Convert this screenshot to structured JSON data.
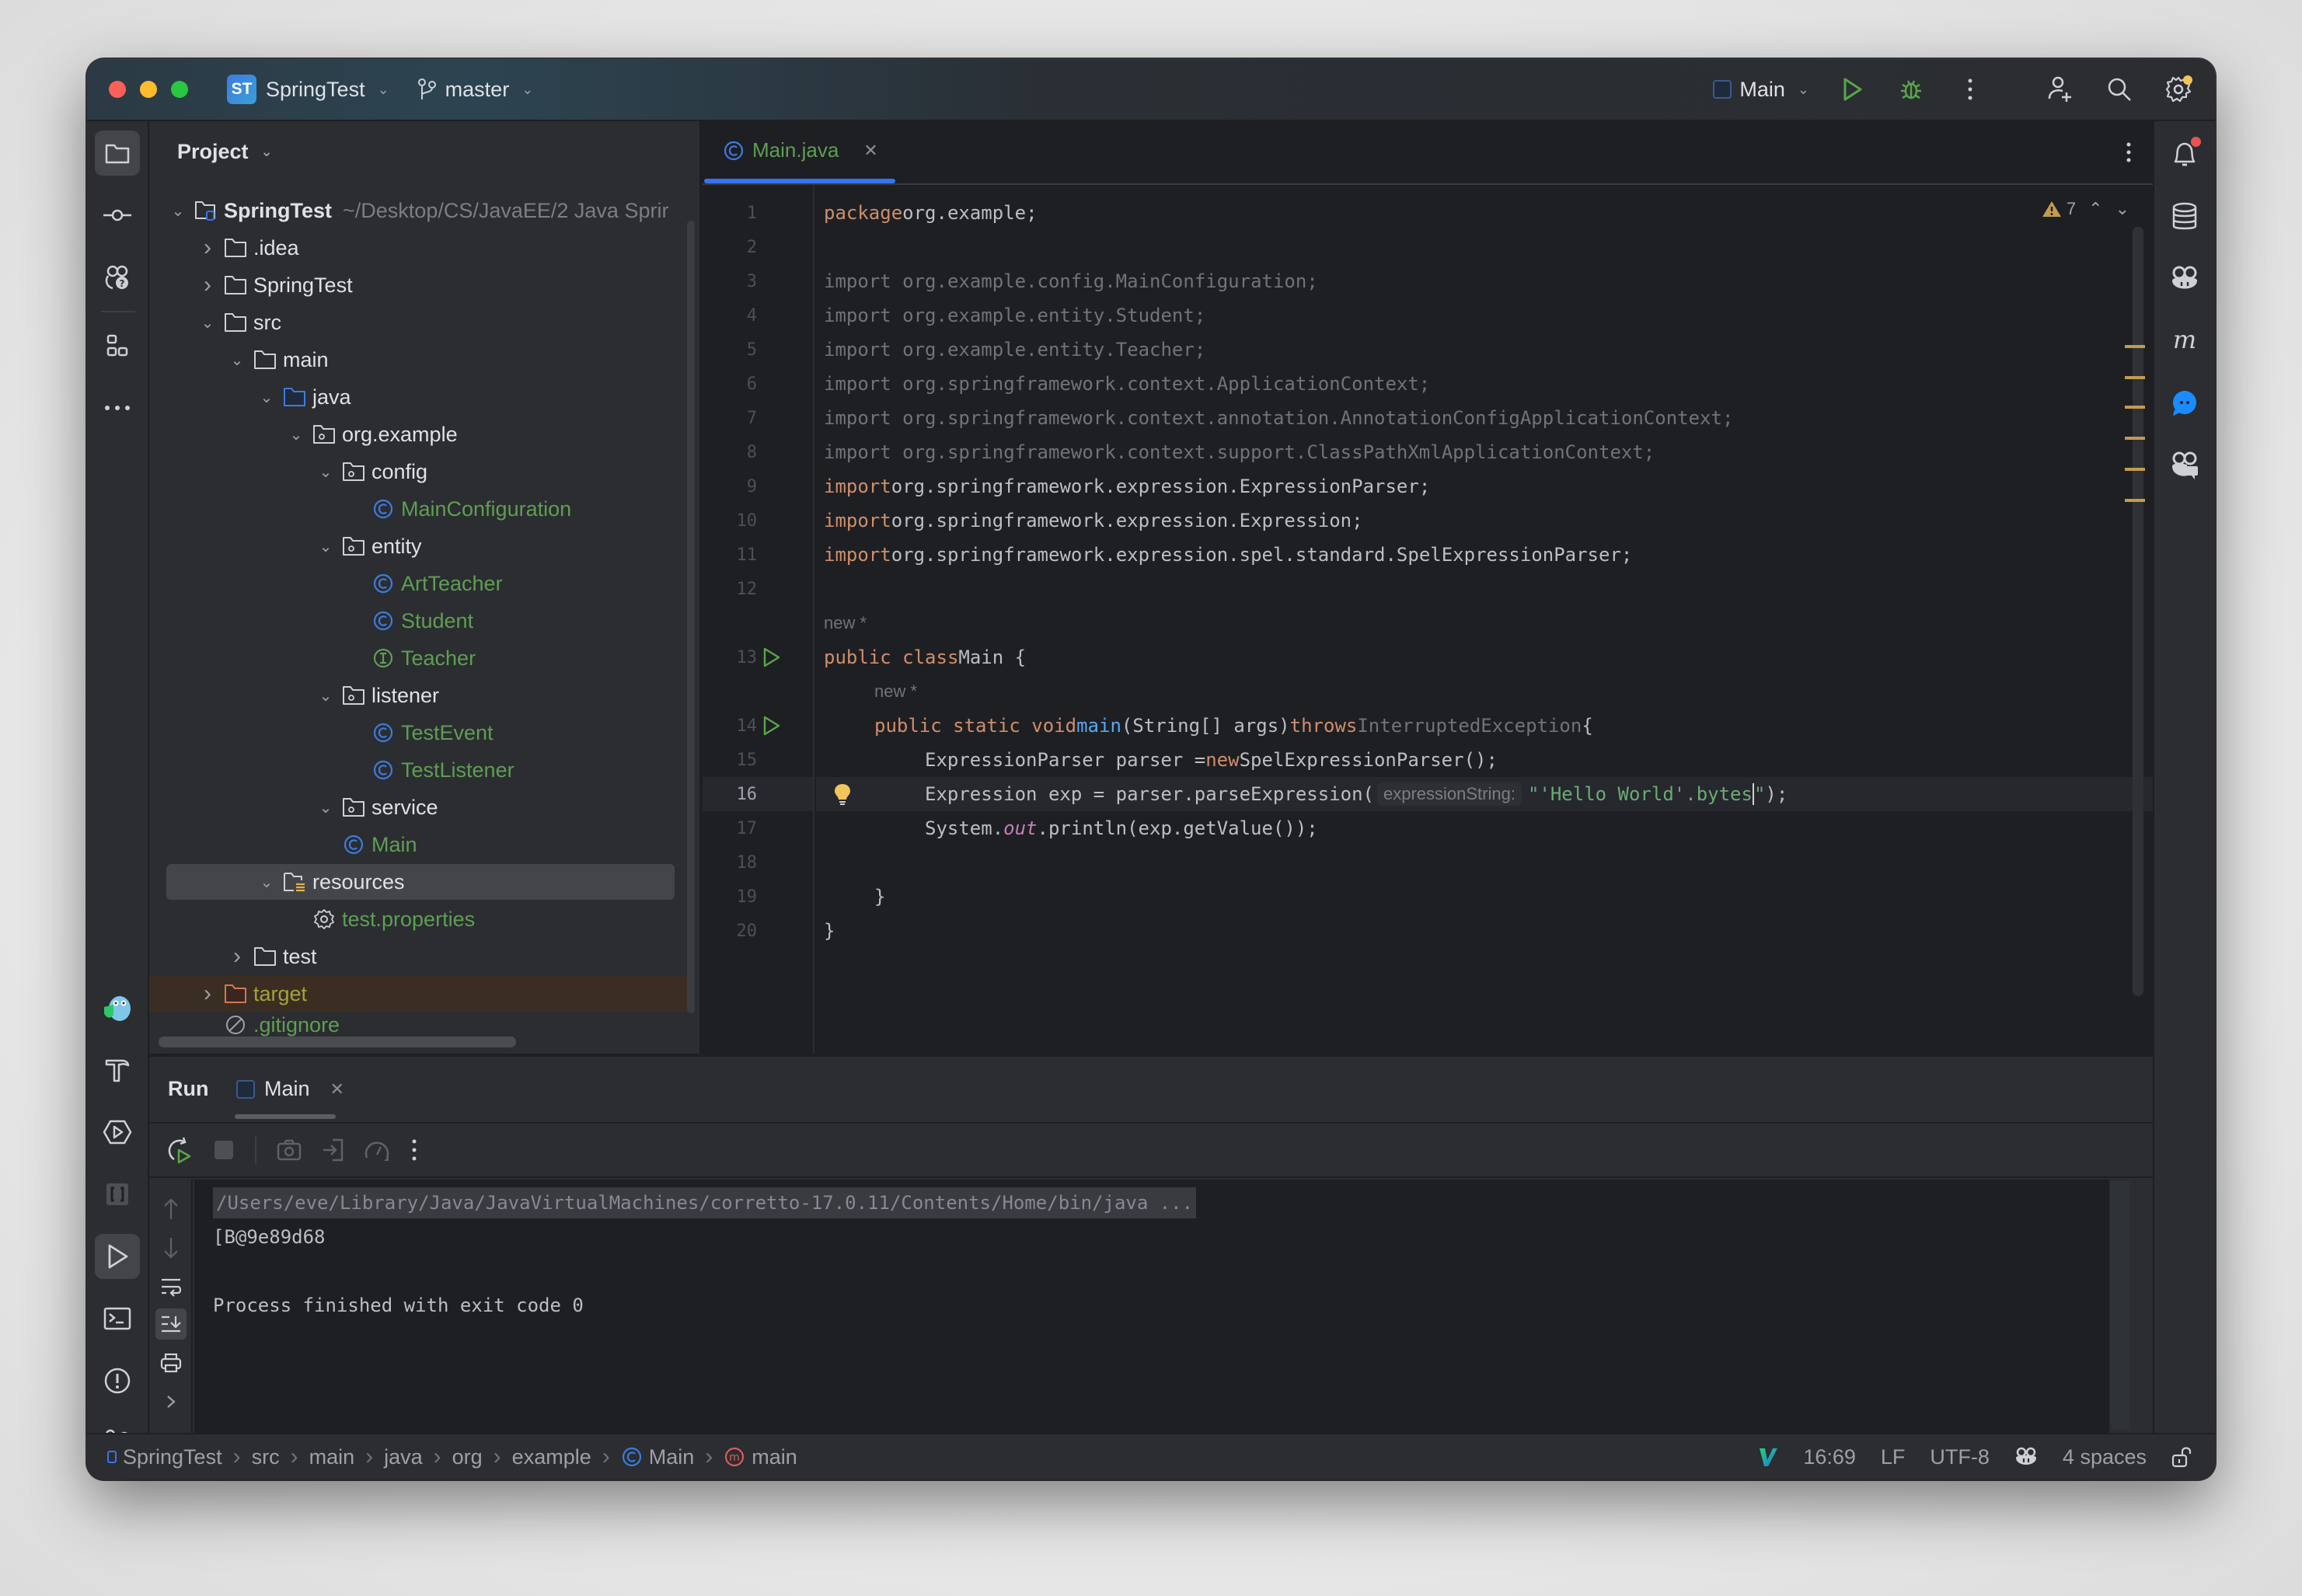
{
  "titlebar": {
    "project_badge": "ST",
    "project_name": "SpringTest",
    "branch": "master",
    "run_config": "Main",
    "icons": [
      "run-icon",
      "debug-icon",
      "more-icon",
      "add-user-icon",
      "search-icon",
      "settings-icon"
    ]
  },
  "left_strip": {
    "items": [
      "project",
      "commit",
      "ai-assistant",
      "structure",
      "more",
      "gopher-plugin",
      "build",
      "services",
      "json-plugin",
      "run",
      "terminal",
      "problems",
      "git"
    ]
  },
  "project_panel": {
    "title": "Project",
    "root": {
      "name": "SpringTest",
      "path": "~/Desktop/CS/JavaEE/2 Java Sprir"
    },
    "tree": [
      {
        "label": ".idea",
        "type": "folder",
        "depth": 1,
        "expanded": false
      },
      {
        "label": "SpringTest",
        "type": "folder",
        "depth": 1,
        "expanded": false
      },
      {
        "label": "src",
        "type": "folder",
        "depth": 1,
        "expanded": true
      },
      {
        "label": "main",
        "type": "folder",
        "depth": 2,
        "expanded": true
      },
      {
        "label": "java",
        "type": "source-folder",
        "depth": 3,
        "expanded": true
      },
      {
        "label": "org.example",
        "type": "package",
        "depth": 4,
        "expanded": true
      },
      {
        "label": "config",
        "type": "package",
        "depth": 5,
        "expanded": true
      },
      {
        "label": "MainConfiguration",
        "type": "class",
        "depth": 6
      },
      {
        "label": "entity",
        "type": "package",
        "depth": 5,
        "expanded": true
      },
      {
        "label": "ArtTeacher",
        "type": "class",
        "depth": 6
      },
      {
        "label": "Student",
        "type": "class",
        "depth": 6
      },
      {
        "label": "Teacher",
        "type": "interface",
        "depth": 6
      },
      {
        "label": "listener",
        "type": "package",
        "depth": 5,
        "expanded": true
      },
      {
        "label": "TestEvent",
        "type": "class",
        "depth": 6
      },
      {
        "label": "TestListener",
        "type": "class",
        "depth": 6
      },
      {
        "label": "service",
        "type": "package",
        "depth": 5,
        "expanded": true
      },
      {
        "label": "Main",
        "type": "class",
        "depth": 5
      },
      {
        "label": "resources",
        "type": "resources-folder",
        "depth": 3,
        "expanded": true,
        "selected": true
      },
      {
        "label": "test.properties",
        "type": "properties",
        "depth": 4
      },
      {
        "label": "test",
        "type": "folder",
        "depth": 2,
        "expanded": false
      },
      {
        "label": "target",
        "type": "excluded-folder",
        "depth": 1,
        "expanded": false
      },
      {
        "label": ".gitignore",
        "type": "ignore-file",
        "depth": 1
      }
    ]
  },
  "editor": {
    "tab": {
      "label": "Main.java"
    },
    "warnings_count": "7",
    "author_hint": "new *",
    "param_hint": "expressionString:",
    "lines": [
      {
        "n": "1",
        "tokens": [
          [
            "kw",
            "package"
          ],
          [
            "",
            "org.example;"
          ]
        ]
      },
      {
        "n": "2",
        "tokens": []
      },
      {
        "n": "3",
        "tokens": [
          [
            "dim",
            "import org.example.config.MainConfiguration;"
          ]
        ]
      },
      {
        "n": "4",
        "tokens": [
          [
            "dim",
            "import org.example.entity.Student;"
          ]
        ]
      },
      {
        "n": "5",
        "tokens": [
          [
            "dim",
            "import org.example.entity.Teacher;"
          ]
        ]
      },
      {
        "n": "6",
        "tokens": [
          [
            "dim",
            "import org.springframework.context.ApplicationContext;"
          ]
        ]
      },
      {
        "n": "7",
        "tokens": [
          [
            "dim",
            "import org.springframework.context.annotation.AnnotationConfigApplicationContext;"
          ]
        ]
      },
      {
        "n": "8",
        "tokens": [
          [
            "dim",
            "import org.springframework.context.support.ClassPathXmlApplicationContext;"
          ]
        ]
      },
      {
        "n": "9",
        "tokens": [
          [
            "kw",
            "import"
          ],
          [
            "",
            "org.springframework.expression.ExpressionParser;"
          ]
        ]
      },
      {
        "n": "10",
        "tokens": [
          [
            "kw",
            "import"
          ],
          [
            "",
            "org.springframework.expression.Expression;"
          ]
        ]
      },
      {
        "n": "11",
        "tokens": [
          [
            "kw",
            "import"
          ],
          [
            "",
            "org.springframework.expression.spel.standard.SpelExpressionParser;"
          ]
        ]
      },
      {
        "n": "12",
        "tokens": []
      },
      {
        "n": "",
        "hint": "new *",
        "indent": 0
      },
      {
        "n": "13",
        "run": true,
        "tokens": [
          [
            "kw",
            "public class"
          ],
          [
            "",
            "Main {"
          ]
        ]
      },
      {
        "n": "",
        "hint": "new *",
        "indent": 1
      },
      {
        "n": "14",
        "run": true,
        "indent": 1,
        "tokens": [
          [
            "kw",
            "public static void"
          ],
          [
            "fn",
            "main"
          ],
          [
            "nospace",
            "(String[] args)"
          ],
          [
            "kw",
            "throws"
          ],
          [
            "dim",
            "InterruptedException"
          ],
          [
            "nospace",
            "{"
          ]
        ]
      },
      {
        "n": "15",
        "indent": 2,
        "tokens": [
          [
            "",
            "ExpressionParser parser ="
          ],
          [
            "kw",
            "new"
          ],
          [
            "",
            "SpelExpressionParser();"
          ]
        ]
      },
      {
        "n": "16",
        "indent": 2,
        "current": true,
        "bulb": true,
        "tokens": [
          [
            "",
            "Expression exp = parser.parseExpression("
          ],
          [
            "hint",
            "expressionString:"
          ],
          [
            "str",
            "\"'Hello World'.bytes"
          ],
          [
            "caret",
            ""
          ],
          [
            "str",
            "\""
          ],
          [
            "nospace",
            ");"
          ]
        ]
      },
      {
        "n": "17",
        "indent": 2,
        "tokens": [
          [
            "",
            "System."
          ],
          [
            "static",
            "out"
          ],
          [
            "nospace",
            ".println(exp.getValue());"
          ]
        ]
      },
      {
        "n": "18",
        "tokens": []
      },
      {
        "n": "19",
        "indent": 1,
        "tokens": [
          [
            "",
            "}"
          ]
        ]
      },
      {
        "n": "20",
        "tokens": [
          [
            "",
            "}"
          ]
        ]
      }
    ]
  },
  "right_strip": {
    "items": [
      "notifications",
      "database",
      "copilot",
      "maven",
      "chat",
      "copilot-chat"
    ]
  },
  "run_panel": {
    "title": "Run",
    "tab_label": "Main",
    "console": [
      "/Users/eve/Library/Java/JavaVirtualMachines/corretto-17.0.11/Contents/Home/bin/java ...",
      "[B@9e89d68",
      "",
      "Process finished with exit code 0"
    ]
  },
  "statusbar": {
    "breadcrumbs": [
      "SpringTest",
      "src",
      "main",
      "java",
      "org",
      "example",
      "Main",
      "main"
    ],
    "position": "16:69",
    "line_separator": "LF",
    "encoding": "UTF-8",
    "indent": "4 spaces"
  },
  "colors": {
    "accent": "#3574f0",
    "keyword": "#cf8e6d",
    "string": "#6aab73",
    "function": "#56a8f5",
    "class_file": "#5f9e55",
    "warning": "#c29b4f",
    "notification_badge": "#e55353",
    "settings_badge": "#f2c55c"
  }
}
